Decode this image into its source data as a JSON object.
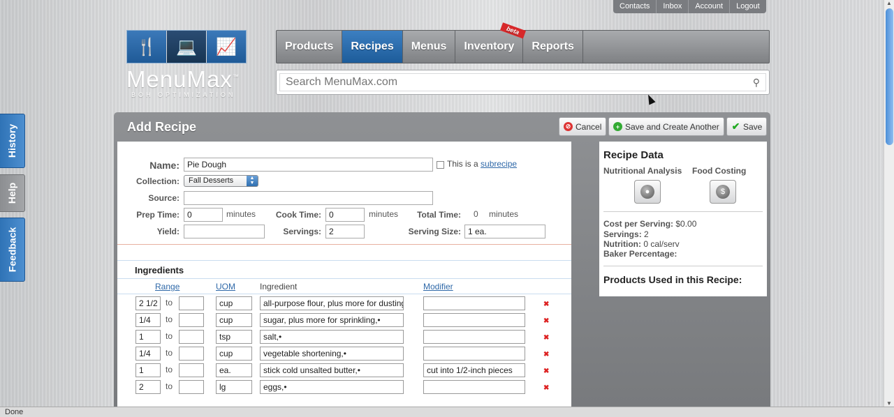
{
  "top_links": [
    "Contacts",
    "Inbox",
    "Account",
    "Logout"
  ],
  "logo": {
    "title": "MenuMax",
    "trademark": "™",
    "subtitle": "BOH OPTIMIZATION"
  },
  "nav": {
    "tabs": [
      "Products",
      "Recipes",
      "Menus",
      "Inventory",
      "Reports"
    ],
    "active": "Recipes",
    "inventory_badge": "beta"
  },
  "search": {
    "placeholder": "Search MenuMax.com"
  },
  "side_tabs": [
    "History",
    "Help",
    "Feedback"
  ],
  "panel": {
    "title": "Add Recipe",
    "buttons": {
      "cancel": "Cancel",
      "save_another": "Save and Create Another",
      "save": "Save"
    }
  },
  "form": {
    "name_label": "Name:",
    "name_value": "Pie Dough",
    "subrecipe_text": "This is a",
    "subrecipe_link": "subrecipe",
    "collection_label": "Collection:",
    "collection_value": "Fall Desserts",
    "source_label": "Source:",
    "source_value": "",
    "prep_time_label": "Prep Time:",
    "prep_time_value": "0",
    "cook_time_label": "Cook Time:",
    "cook_time_value": "0",
    "total_time_label": "Total Time:",
    "total_time_value": "0",
    "minutes": "minutes",
    "yield_label": "Yield:",
    "yield_value": "",
    "servings_label": "Servings:",
    "servings_value": "2",
    "serving_size_label": "Serving Size:",
    "serving_size_value": "1 ea."
  },
  "ingredients": {
    "title": "Ingredients",
    "headers": {
      "range": "Range",
      "uom": "UOM",
      "ingredient": "Ingredient",
      "modifier": "Modifier"
    },
    "to": "to",
    "rows": [
      {
        "range_from": "2 1/2",
        "range_to": "",
        "uom": "cup",
        "ingredient": "all-purpose flour, plus more for dusting",
        "modifier": ""
      },
      {
        "range_from": "1/4",
        "range_to": "",
        "uom": "cup",
        "ingredient": "sugar, plus more for sprinkling,•",
        "modifier": ""
      },
      {
        "range_from": "1",
        "range_to": "",
        "uom": "tsp",
        "ingredient": "salt,•",
        "modifier": ""
      },
      {
        "range_from": "1/4",
        "range_to": "",
        "uom": "cup",
        "ingredient": "vegetable shortening,•",
        "modifier": ""
      },
      {
        "range_from": "1",
        "range_to": "",
        "uom": "ea.",
        "ingredient": "stick cold unsalted butter,•",
        "modifier": "cut into 1/2-inch pieces"
      },
      {
        "range_from": "2",
        "range_to": "",
        "uom": "lg",
        "ingredient": "eggs,•",
        "modifier": ""
      }
    ]
  },
  "recipe_data": {
    "title": "Recipe Data",
    "nutritional_analysis": "Nutritional Analysis",
    "food_costing": "Food Costing",
    "cost_label": "Cost per Serving:",
    "cost_value": "$0.00",
    "servings_label": "Servings:",
    "servings_value": "2",
    "nutrition_label": "Nutrition:",
    "nutrition_value": "0 cal/serv",
    "baker_label": "Baker Percentage:",
    "products_used": "Products Used in this Recipe:"
  },
  "status_bar": "Done",
  "colors": {
    "accent": "#2f6fb0",
    "panel": "#838588",
    "delete": "#d22222"
  }
}
